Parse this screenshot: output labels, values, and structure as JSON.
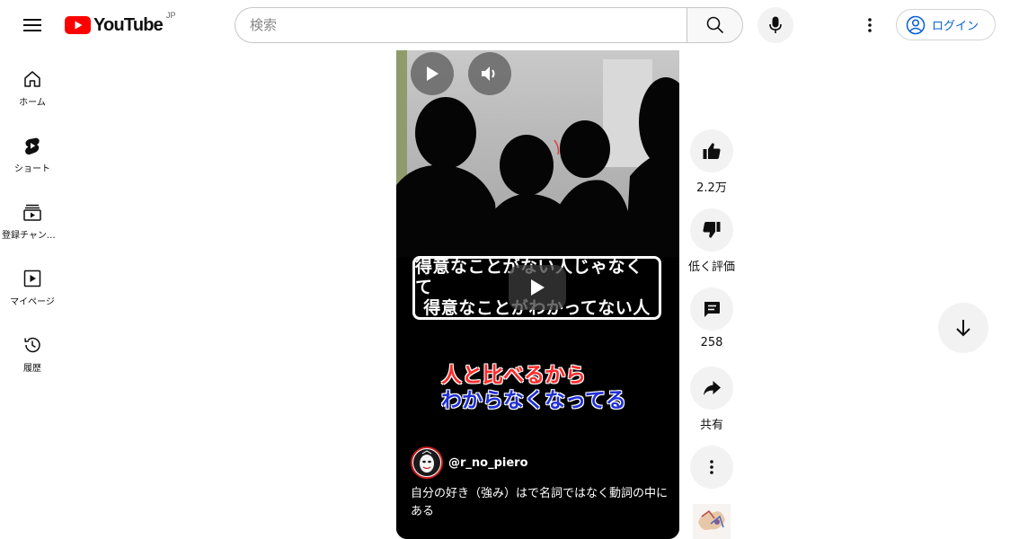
{
  "header": {
    "logo_text": "YouTube",
    "country": "JP",
    "search_placeholder": "検索",
    "login_label": "ログイン"
  },
  "sidebar": {
    "items": [
      {
        "label": "ホーム",
        "icon": "home-icon"
      },
      {
        "label": "ショート",
        "icon": "shorts-icon"
      },
      {
        "label": "登録チャンネル",
        "icon": "subscriptions-icon"
      },
      {
        "label": "マイページ",
        "icon": "library-icon"
      },
      {
        "label": "履歴",
        "icon": "history-icon"
      }
    ]
  },
  "video": {
    "caption_line1": "得意なことがない人じゃなくて",
    "caption_line2": "得意なことがわかってない人",
    "subtitle_red": "人と比べるから",
    "subtitle_blue": "わからなくなってる",
    "channel_handle": "@r_no_piero",
    "title": "自分の好き（強み）はで名詞ではなく動詞の中にある"
  },
  "actions": {
    "like_count": "2.2万",
    "dislike_label": "低く評価",
    "comment_count": "258",
    "share_label": "共有"
  },
  "colors": {
    "brand_red": "#ff0000",
    "link_blue": "#065fd4",
    "subtitle_red": "#ff2a2a",
    "subtitle_blue": "#1f2fd6"
  }
}
